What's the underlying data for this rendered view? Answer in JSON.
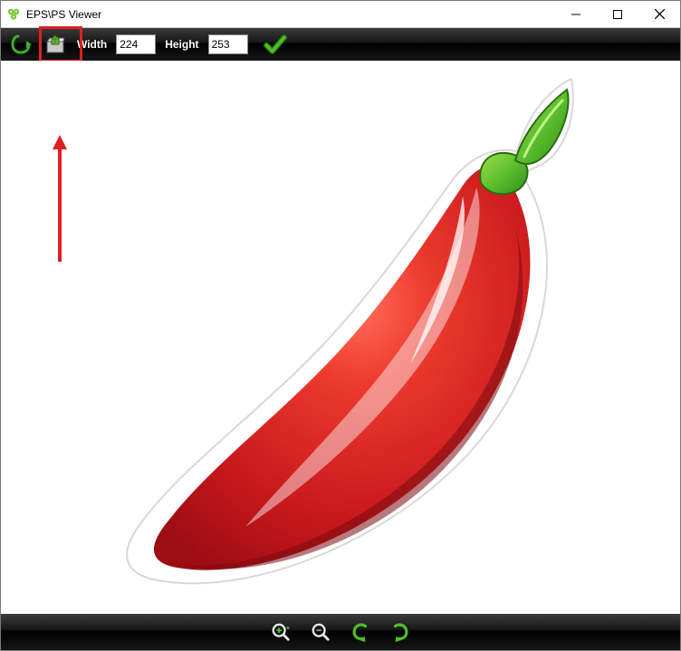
{
  "titlebar": {
    "title": "EPS\\PS Viewer"
  },
  "toolbar": {
    "width_label": "Width",
    "width_value": "224",
    "height_label": "Height",
    "height_value": "253"
  },
  "annotation": {
    "highlight_target": "save-button",
    "arrow_color": "#e02020"
  }
}
